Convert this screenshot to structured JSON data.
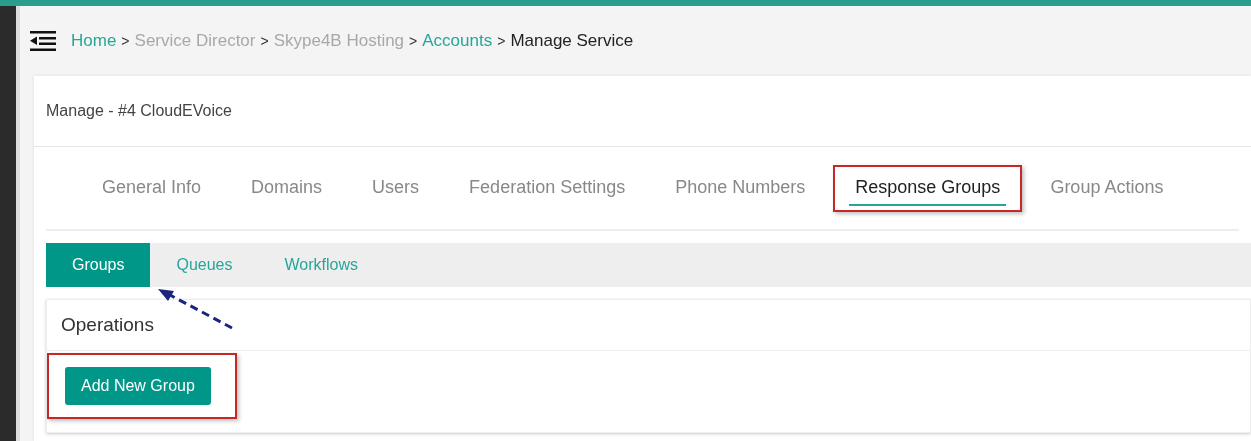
{
  "breadcrumb": [
    {
      "text": "Home",
      "kind": "link"
    },
    {
      "text": ">",
      "kind": "separator"
    },
    {
      "text": "Service Director",
      "kind": "muted"
    },
    {
      "text": ">",
      "kind": "separator"
    },
    {
      "text": "Skype4B Hosting",
      "kind": "muted"
    },
    {
      "text": ">",
      "kind": "separator"
    },
    {
      "text": "Accounts",
      "kind": "link"
    },
    {
      "text": ">",
      "kind": "separator"
    },
    {
      "text": "Manage Service",
      "kind": "current"
    }
  ],
  "page_title": "Manage - #4 CloudEVoice",
  "tabs": [
    {
      "label": "General Info",
      "selected": false,
      "highlighted": false
    },
    {
      "label": "Domains",
      "selected": false,
      "highlighted": false
    },
    {
      "label": "Users",
      "selected": false,
      "highlighted": false
    },
    {
      "label": "Federation Settings",
      "selected": false,
      "highlighted": false
    },
    {
      "label": "Phone Numbers",
      "selected": false,
      "highlighted": false
    },
    {
      "label": "Response Groups",
      "selected": true,
      "highlighted": true
    },
    {
      "label": "Group Actions",
      "selected": false,
      "highlighted": false
    }
  ],
  "subtabs": [
    {
      "label": "Groups",
      "selected": true
    },
    {
      "label": "Queues",
      "selected": false
    },
    {
      "label": "Workflows",
      "selected": false
    }
  ],
  "operations": {
    "title": "Operations",
    "button": {
      "label": "Add New Group",
      "highlighted": true
    }
  }
}
